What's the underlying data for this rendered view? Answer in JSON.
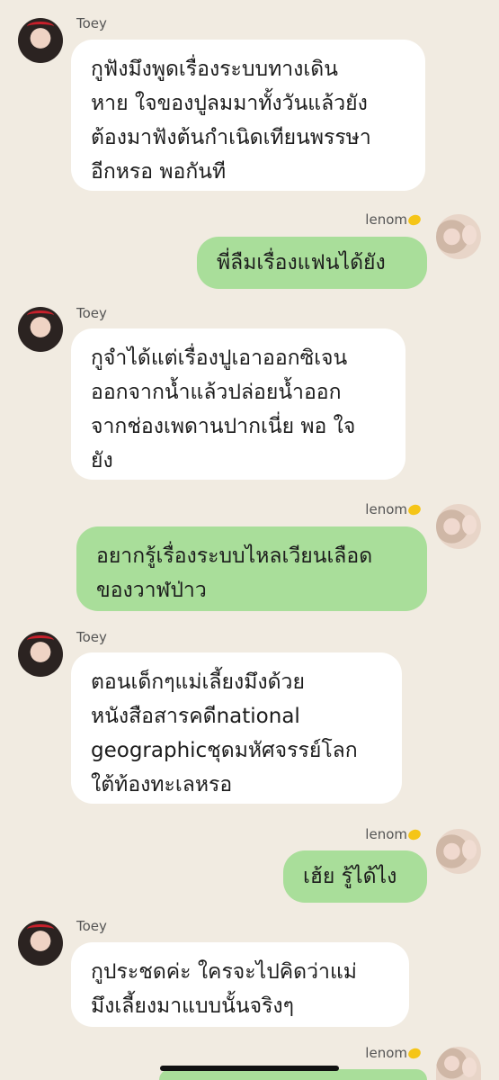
{
  "messages": [
    {
      "sender": "Toey",
      "direction": "in",
      "lines": [
        "กูฟังมึงพูดเรื่องระบบทางเดิน",
        "หาย ใจของปูลมมาทั้งวันแล้วยัง",
        "ต้องมาฟังต้นกำเนิดเทียนพรรษา",
        "อีกหรอ พอกันที"
      ]
    },
    {
      "sender": "lenom",
      "direction": "out",
      "lines": [
        "พี่ลืมเรื่องแฟนได้ยัง"
      ]
    },
    {
      "sender": "Toey",
      "direction": "in",
      "lines": [
        "กูจำได้แต่เรื่องปูเอาออกซิเจน",
        "ออกจากน้ำแล้วปล่อยน้ำออก",
        "จากช่องเพดานปากเนี่ย พอ ใจ",
        "ยัง"
      ]
    },
    {
      "sender": "lenom",
      "direction": "out",
      "lines": [
        "อยากรู้เรื่องระบบไหลเวียนเลือด",
        "ของวาฬป่าว"
      ]
    },
    {
      "sender": "Toey",
      "direction": "in",
      "lines": [
        "ตอนเด็กๆแม่เลี้ยงมึงด้วย",
        "หนังสือสารคดีnational",
        "geographicชุดมหัศจรรย์โลก",
        "ใต้ท้องทะเลหรอ"
      ]
    },
    {
      "sender": "lenom",
      "direction": "out",
      "lines": [
        "เฮ้ย รู้ได้ไง"
      ]
    },
    {
      "sender": "Toey",
      "direction": "in",
      "lines": [
        "กูประชดค่ะ ใครจะไปคิดว่าแม่",
        "มึงเลี้ยงมาแบบนั้นจริงๆ"
      ]
    },
    {
      "sender": "lenom",
      "direction": "out",
      "lines": []
    }
  ],
  "colors": {
    "background": "#f1ebe1",
    "incoming_bubble": "#ffffff",
    "outgoing_bubble": "#a9de9a"
  }
}
